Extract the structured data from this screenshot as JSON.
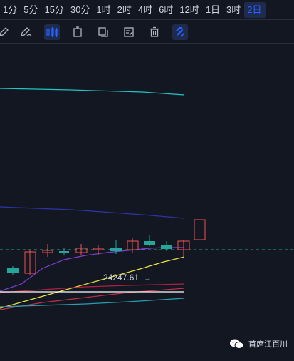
{
  "timeframes": [
    "1分",
    "5分",
    "15分",
    "30分",
    "1时",
    "2时",
    "4时",
    "6时",
    "12时",
    "1日",
    "3时",
    "2日"
  ],
  "active_timeframe": "2日",
  "toolbar": {
    "icons": [
      "pencil-icon",
      "brush-icon",
      "candles-icon",
      "hourglass-icon",
      "copy-icon",
      "edit-note-icon",
      "trash-icon",
      "magnet-icon"
    ],
    "active": "candles-icon"
  },
  "price_marker": {
    "text": "24247.61",
    "arrow": "→"
  },
  "watermark": {
    "text": "首席江百川"
  },
  "colors": {
    "up": "#26a69a",
    "down": "#ef5350",
    "cyan": "#1fc4c4",
    "navy": "#2e33a8",
    "purple": "#7e3fd0",
    "yellow": "#e9e23f",
    "white": "#ffffff",
    "crimson": "#b02040",
    "teal": "#2a9db3"
  }
}
